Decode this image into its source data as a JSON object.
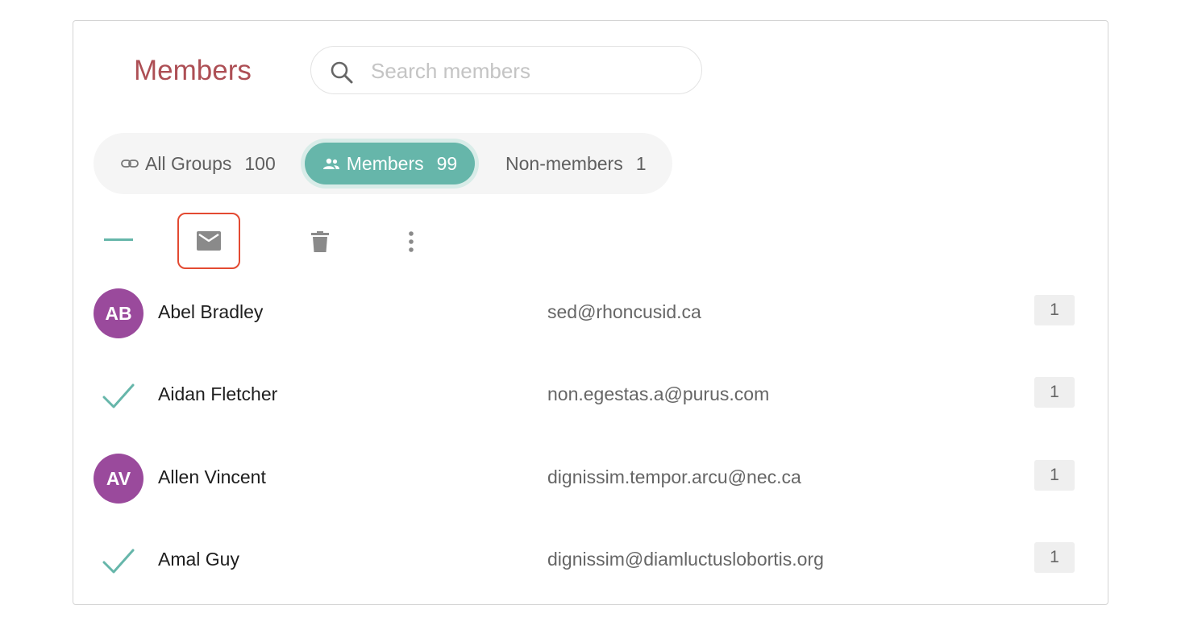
{
  "header": {
    "title": "Members",
    "search_placeholder": "Search members",
    "search_value": ""
  },
  "filters": [
    {
      "label": "All Groups",
      "count": "100",
      "icon": "link-icon"
    },
    {
      "label": "Members",
      "count": "99",
      "icon": "people-icon",
      "active": true
    },
    {
      "label": "Non-members",
      "count": "1"
    }
  ],
  "toolbar": {
    "icons": [
      "select-all-dash-icon",
      "mail-icon",
      "trash-icon",
      "more-vertical-icon"
    ]
  },
  "members": [
    {
      "initials": "AB",
      "name": "Abel Bradley",
      "email": "sed@rhoncusid.ca",
      "count": "1",
      "selected": false
    },
    {
      "initials": "",
      "name": "Aidan Fletcher",
      "email": "non.egestas.a@purus.com",
      "count": "1",
      "selected": true
    },
    {
      "initials": "AV",
      "name": "Allen Vincent",
      "email": "dignissim.tempor.arcu@nec.ca",
      "count": "1",
      "selected": false
    },
    {
      "initials": "",
      "name": "Amal Guy",
      "email": "dignissim@diamluctuslobortis.org",
      "count": "1",
      "selected": true
    }
  ],
  "colors": {
    "accent": "#66b6aa",
    "title": "#ad4f55",
    "avatar": "#9a4a9c",
    "highlight": "#e34a32"
  }
}
